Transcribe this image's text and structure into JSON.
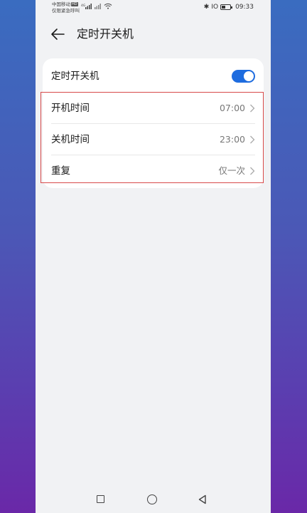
{
  "status_bar": {
    "carrier_line1": "中国移动",
    "hd_badge": "HD",
    "carrier_line2": "仅限紧急呼叫",
    "signal1_label": "4G",
    "bluetooth": "✱",
    "vibrate": "IO",
    "time": "09:33",
    "battery_level": 0.45
  },
  "header": {
    "title": "定时开关机"
  },
  "settings": {
    "toggle_row": {
      "label": "定时开关机",
      "enabled": true
    },
    "rows": [
      {
        "label": "开机时间",
        "value": "07:00"
      },
      {
        "label": "关机时间",
        "value": "23:00"
      },
      {
        "label": "重复",
        "value": "仅一次"
      }
    ]
  },
  "colors": {
    "accent": "#1e6cdf",
    "highlight": "#d84a4a",
    "page_bg": "#f1f2f4"
  }
}
